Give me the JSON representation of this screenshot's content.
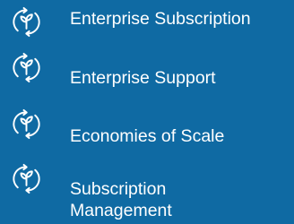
{
  "features": [
    {
      "label": "Enterprise Subscription",
      "icon": "sprout-cycle-icon"
    },
    {
      "label": "Enterprise Support",
      "icon": "sprout-cycle-icon"
    },
    {
      "label": "Economies of Scale",
      "icon": "sprout-cycle-icon"
    },
    {
      "label": "Subscription Management",
      "icon": "sprout-cycle-icon"
    }
  ],
  "colors": {
    "background": "#0f6aa3",
    "foreground": "#ffffff"
  }
}
